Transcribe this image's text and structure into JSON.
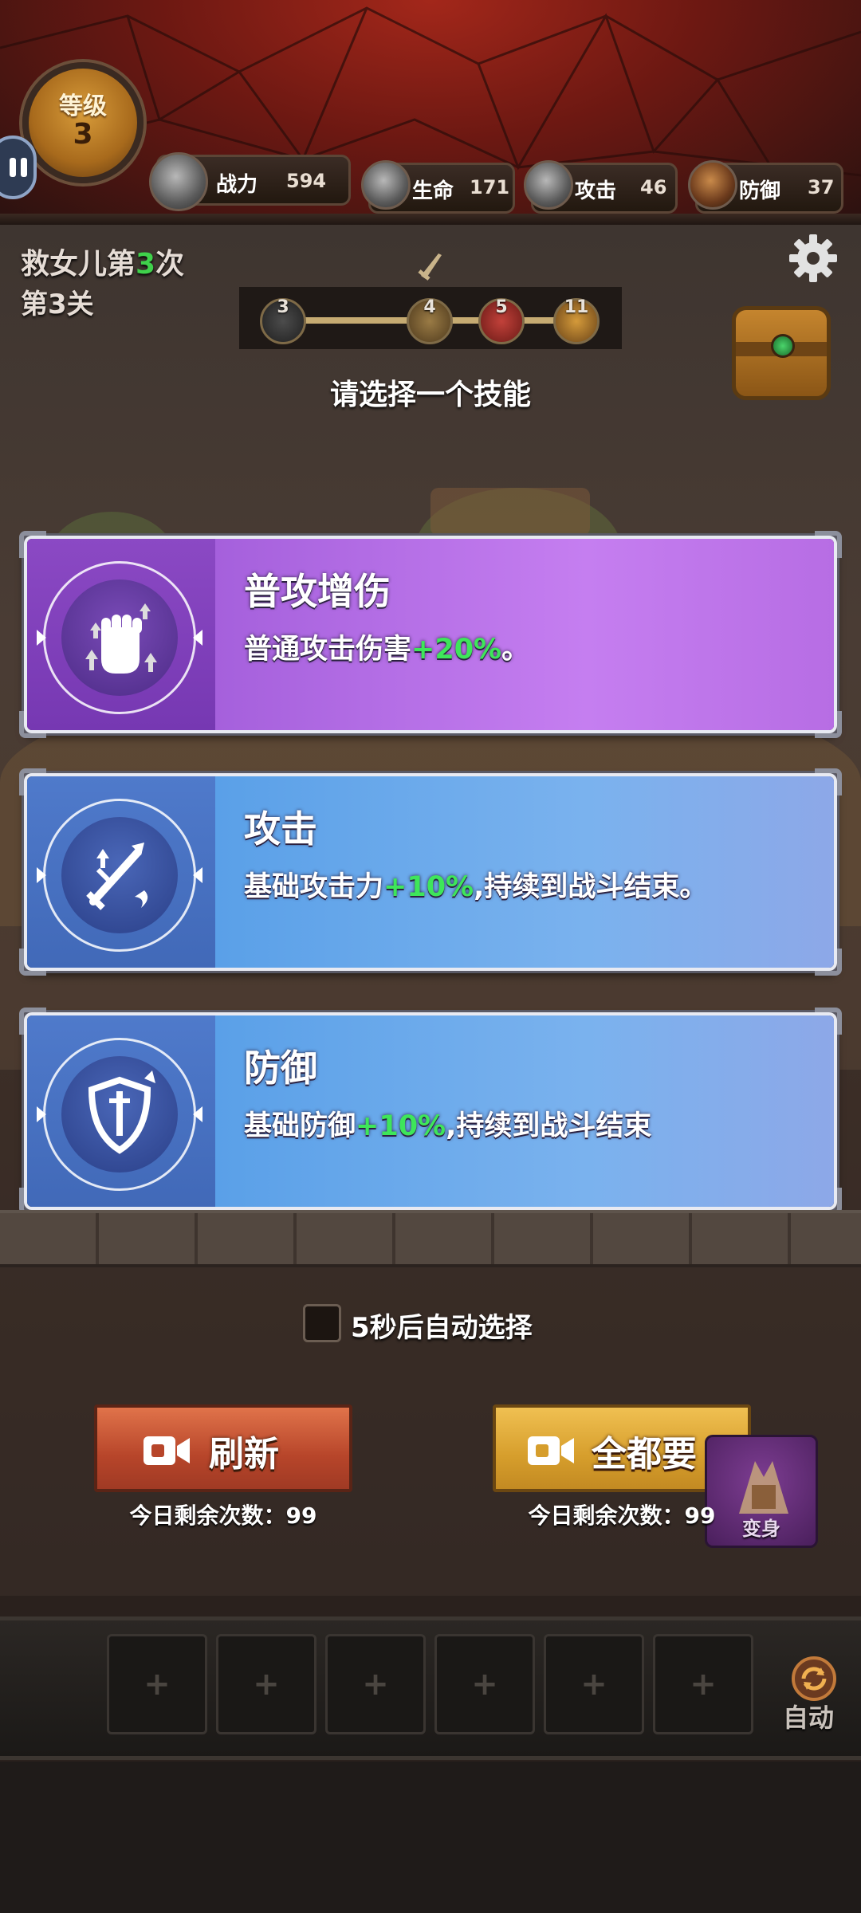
{
  "header": {
    "level_label": "等级",
    "level_value": "3",
    "stats": [
      {
        "icon": "power-shield-icon",
        "name": "战力",
        "value": "594"
      },
      {
        "icon": "armor-hp-icon",
        "name": "生命",
        "value": "171"
      },
      {
        "icon": "sword-attack-icon",
        "name": "攻击",
        "value": "46"
      },
      {
        "icon": "shield-defense-icon",
        "name": "防御",
        "value": "37"
      }
    ]
  },
  "stage": {
    "rescue_prefix": "救女儿第",
    "rescue_count": "3",
    "rescue_suffix": "次",
    "level": "第3关",
    "progress_nodes": [
      "3",
      "4",
      "5",
      "11"
    ]
  },
  "prompt": "请选择一个技能",
  "skills": [
    {
      "title": "普攻增伤",
      "desc_prefix": "普通攻击伤害",
      "desc_bonus": "+20%",
      "desc_suffix": "。",
      "icon": "fist-power-icon",
      "color": "#b76de4"
    },
    {
      "title": "攻击",
      "desc_prefix": "基础攻击力",
      "desc_bonus": "+10%",
      "desc_suffix": ",持续到战斗结束。",
      "icon": "sword-buff-icon",
      "color": "#7ab2ee"
    },
    {
      "title": "防御",
      "desc_prefix": "基础防御",
      "desc_bonus": "+10%",
      "desc_suffix": ",持续到战斗结束",
      "icon": "shield-sword-icon",
      "color": "#7ab2ee"
    }
  ],
  "auto_select": "5秒后自动选择",
  "buttons": {
    "refresh": {
      "label": "刷新",
      "remaining": "今日剩余次数：99"
    },
    "take_all": {
      "label": "全都要",
      "remaining": "今日剩余次数：99"
    },
    "transform": "变身",
    "auto": "自动"
  },
  "slots": [
    "+",
    "+",
    "+",
    "+",
    "+",
    "+"
  ],
  "colors": {
    "bonus_green": "#3ee65a",
    "rescue_green": "#3fd14b",
    "refresh_button": "#b7452a",
    "take_all_button": "#d69e2c"
  }
}
